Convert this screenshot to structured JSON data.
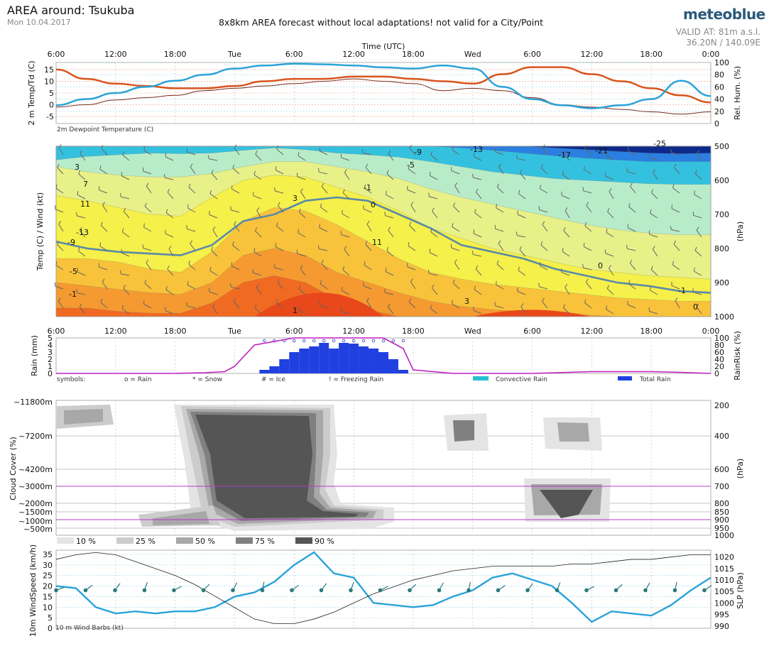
{
  "header": {
    "title": "AREA around: Tsukuba",
    "date": "Mon 10.04.2017",
    "subtitle": "8x8km AREA forecast without local adaptations! not valid for a City/Point",
    "brand": "meteoblue",
    "valid_at": "VALID AT: 81m a.s.l.",
    "coords": "36.20N / 140.09E"
  },
  "colors": {
    "temp": "#d9541e",
    "dewpoint": "#7a2a1a",
    "humidity": "#2aa3d8",
    "rain_bar": "#2040e0",
    "rain_risk": "#c020c0",
    "freezing": "#5a8aa8",
    "wind": "#2aa3d8",
    "slp": "#222222",
    "cloud": "#555555"
  },
  "time_axis": {
    "title": "Time (UTC)",
    "ticks": [
      "6:00",
      "12:00",
      "18:00",
      "Tue",
      "6:00",
      "12:00",
      "18:00",
      "Wed",
      "6:00",
      "12:00",
      "18:00",
      "0:00"
    ]
  },
  "panel_temp": {
    "ylabel_left": "2 m Temp/Td (C)",
    "ylabel_right": "Rel. Hum. (%)",
    "legend": "2m Dewpoint Temperature (C)",
    "yticks_left": [
      "15",
      "10",
      "5",
      "0",
      "-5"
    ],
    "yticks_right": [
      "100",
      "80",
      "60",
      "40",
      "20",
      "0"
    ]
  },
  "panel_profile": {
    "ylabel_left": "Temp (C) / Wind (kt)",
    "ylabel_right": "(hPa)",
    "yticks_right": [
      "500",
      "600",
      "700",
      "800",
      "900",
      "1000"
    ],
    "contour_labels": [
      "-25",
      "-21",
      "-17",
      "-13",
      "-9",
      "-5",
      "-1",
      "0",
      "3",
      "7",
      "11",
      "-13",
      "-9",
      "-5",
      "-1",
      "1",
      "3",
      "0",
      "-1",
      "0",
      "3",
      "11"
    ]
  },
  "panel_rain": {
    "ylabel_left": "Rain (mm)",
    "ylabel_right": "RainRisk (%)",
    "yticks_left": [
      "5",
      "4",
      "3",
      "2",
      "1",
      "0"
    ],
    "yticks_right": [
      "100",
      "80",
      "60",
      "40",
      "20",
      "0"
    ],
    "legend": {
      "symbols": "symbols:",
      "rain": "o = Rain",
      "snow": "* = Snow",
      "ice": "# = Ice",
      "freezing": "! = Freezing Rain",
      "convective": "Convective Rain",
      "total": "Total Rain"
    }
  },
  "panel_cloud": {
    "ylabel_left": "Cloud Cover (%)",
    "ylabel_right": "(hPa)",
    "yticks_left": [
      "~11800m",
      "~7200m",
      "~4200m",
      "~3000m",
      "~2000m",
      "~1500m",
      "~1000m",
      "~500m"
    ],
    "yticks_right": [
      "200",
      "400",
      "600",
      "700",
      "800",
      "850",
      "900",
      "950",
      "1000"
    ],
    "legend": [
      "10 %",
      "25 %",
      "50 %",
      "75 %",
      "90 %"
    ]
  },
  "panel_wind": {
    "ylabel_left": "10m WindSpeed (km/h)",
    "ylabel_right": "SLP (hPa)",
    "legend": "10 m Wind Barbs (kt)",
    "yticks_left": [
      "35",
      "30",
      "25",
      "20",
      "15",
      "10",
      "5",
      "0"
    ],
    "yticks_right": [
      "1020",
      "1015",
      "1010",
      "1005",
      "1000",
      "995",
      "990"
    ]
  },
  "chart_data": [
    {
      "type": "line",
      "panel": "temperature",
      "x_hours": [
        0,
        3,
        6,
        9,
        12,
        15,
        18,
        21,
        24,
        27,
        30,
        33,
        36,
        39,
        42,
        45,
        48,
        51,
        54,
        57,
        60,
        63,
        66
      ],
      "series": [
        {
          "name": "2 m Temp",
          "axis": "left",
          "values": [
            15,
            11,
            9,
            8,
            7,
            7,
            8,
            10,
            11,
            11,
            12,
            12,
            11,
            10,
            9,
            13,
            16,
            16,
            13,
            10,
            7,
            4,
            1
          ]
        },
        {
          "name": "2m Dewpoint Temperature (C)",
          "axis": "left",
          "values": [
            -1,
            0,
            2,
            3,
            4,
            6,
            7,
            8,
            9,
            10,
            11,
            10,
            9,
            6,
            7,
            6,
            3,
            0,
            -1,
            -2,
            -3,
            -4,
            -3
          ]
        },
        {
          "name": "Rel. Hum.",
          "axis": "right",
          "values": [
            30,
            40,
            50,
            60,
            70,
            80,
            90,
            95,
            98,
            97,
            95,
            92,
            90,
            95,
            90,
            60,
            40,
            30,
            25,
            30,
            40,
            70,
            45
          ]
        }
      ],
      "ylim_left": [
        -8,
        18
      ],
      "ylim_right": [
        0,
        100
      ]
    },
    {
      "type": "heatmap",
      "panel": "temperature profile",
      "x_hours_range": [
        0,
        66
      ],
      "y_pressure_range": [
        500,
        1000
      ],
      "freezing_level_hpa": [
        780,
        800,
        810,
        815,
        820,
        790,
        720,
        700,
        660,
        650,
        660,
        700,
        740,
        790,
        810,
        830,
        860,
        880,
        900,
        910,
        925,
        930
      ]
    },
    {
      "type": "bar",
      "panel": "rain",
      "x_hours": [
        21,
        22,
        23,
        24,
        25,
        26,
        27,
        28,
        29,
        30,
        31,
        32,
        33,
        34,
        35
      ],
      "values": [
        0.5,
        1,
        2,
        3,
        3.5,
        3.8,
        4.3,
        3.5,
        4.3,
        4.2,
        3.8,
        3.5,
        3,
        2,
        0.5
      ],
      "ylim": [
        0,
        5
      ],
      "rain_risk": {
        "x_hours": [
          0,
          12,
          15,
          17,
          18,
          20,
          24,
          27,
          33,
          35,
          36,
          40,
          48,
          54,
          60,
          63,
          66
        ],
        "values": [
          0,
          0,
          2,
          5,
          20,
          80,
          100,
          100,
          100,
          70,
          10,
          0,
          0,
          5,
          5,
          3,
          0
        ]
      }
    },
    {
      "type": "line",
      "panel": "wind",
      "x_hours": [
        0,
        2,
        4,
        6,
        8,
        10,
        12,
        14,
        16,
        18,
        20,
        22,
        24,
        26,
        28,
        30,
        32,
        34,
        36,
        38,
        40,
        42,
        44,
        46,
        48,
        50,
        52,
        54,
        56,
        58,
        60,
        62,
        64,
        66
      ],
      "series": [
        {
          "name": "10m WindSpeed",
          "axis": "left",
          "values": [
            20,
            19,
            10,
            7,
            8,
            7,
            8,
            8,
            10,
            15,
            17,
            22,
            30,
            36,
            26,
            24,
            12,
            11,
            10,
            11,
            15,
            18,
            24,
            26,
            23,
            20,
            12,
            3,
            8,
            7,
            6,
            11,
            18,
            24
          ]
        },
        {
          "name": "SLP",
          "axis": "right",
          "values": [
            1019,
            1021,
            1022,
            1021,
            1018,
            1015,
            1012,
            1008,
            1003,
            998,
            993,
            991,
            991,
            993,
            996,
            1000,
            1004,
            1007,
            1010,
            1012,
            1014,
            1015,
            1016,
            1016,
            1016,
            1016,
            1017,
            1017,
            1018,
            1019,
            1019,
            1020,
            1021,
            1021
          ]
        }
      ],
      "ylim_left": [
        0,
        37
      ],
      "ylim_right": [
        989,
        1023
      ]
    }
  ]
}
